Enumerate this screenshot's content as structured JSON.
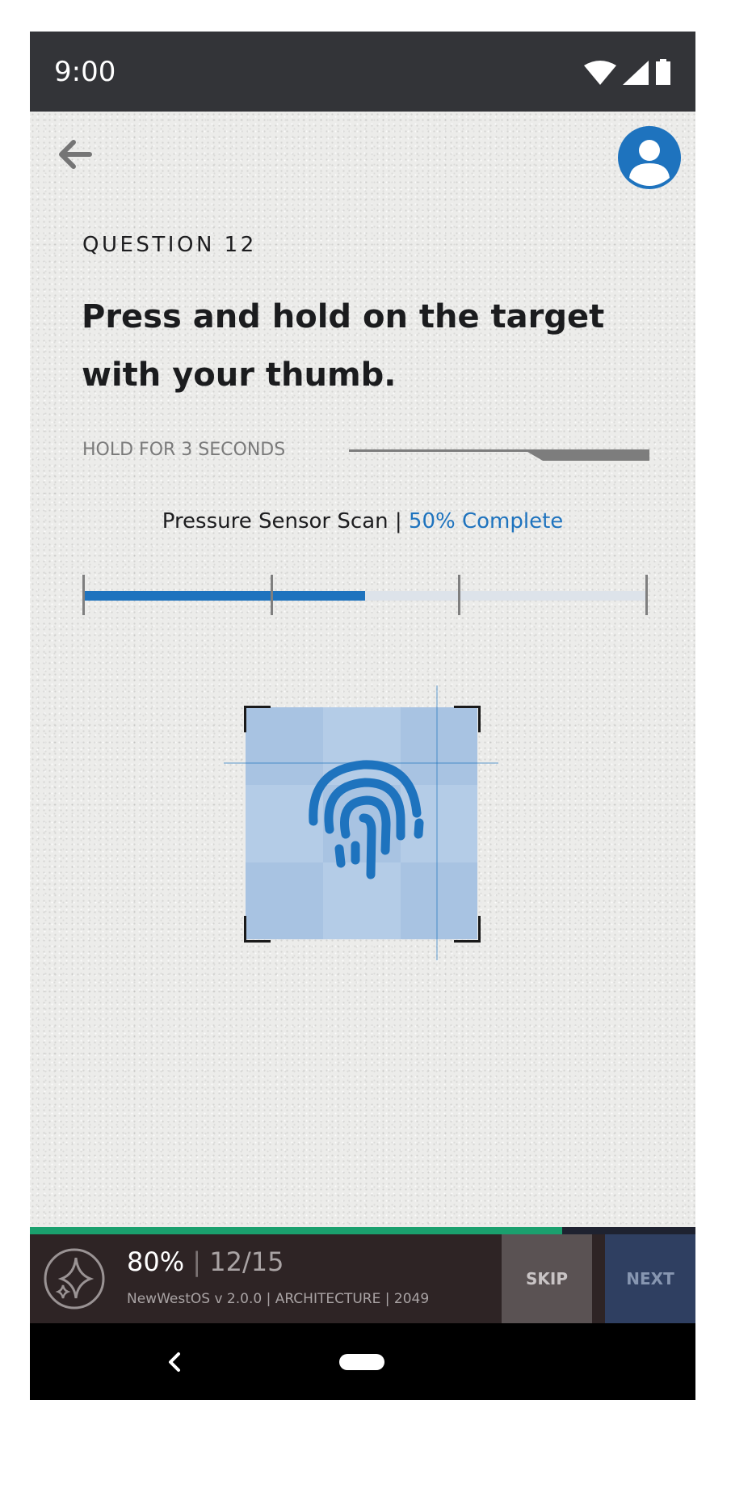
{
  "status_bar": {
    "time": "9:00",
    "icons": [
      "wifi-icon",
      "signal-icon",
      "battery-icon"
    ]
  },
  "header": {
    "back_icon": "arrow-left-icon",
    "profile_icon": "user-avatar-icon"
  },
  "question": {
    "label": "QUESTION 12",
    "prompt": "Press and hold on the target with your thumb."
  },
  "hold": {
    "label": "HOLD FOR 3 SECONDS"
  },
  "scan": {
    "label": "Pressure Sensor Scan",
    "separator": " | ",
    "status": "50% Complete",
    "progress": 0.5,
    "checkpoints": 3
  },
  "target": {
    "icon": "fingerprint-icon"
  },
  "footer": {
    "overall_progress": 0.8,
    "percent": "80%",
    "separator": " | ",
    "count": "12/15",
    "meta": "NewWestOS v 2.0.0 | ARCHITECTURE | 2049",
    "logo_icon": "sparkle-logo-icon",
    "skip_label": "SKIP",
    "next_label": "NEXT"
  },
  "nav": {
    "back_icon": "nav-back-icon",
    "home_icon": "home-pill-icon"
  },
  "colors": {
    "accent": "#1e73be",
    "progress_green": "#1aa06e",
    "status_bar": "#333438",
    "footer_bg": "#2e2425"
  }
}
